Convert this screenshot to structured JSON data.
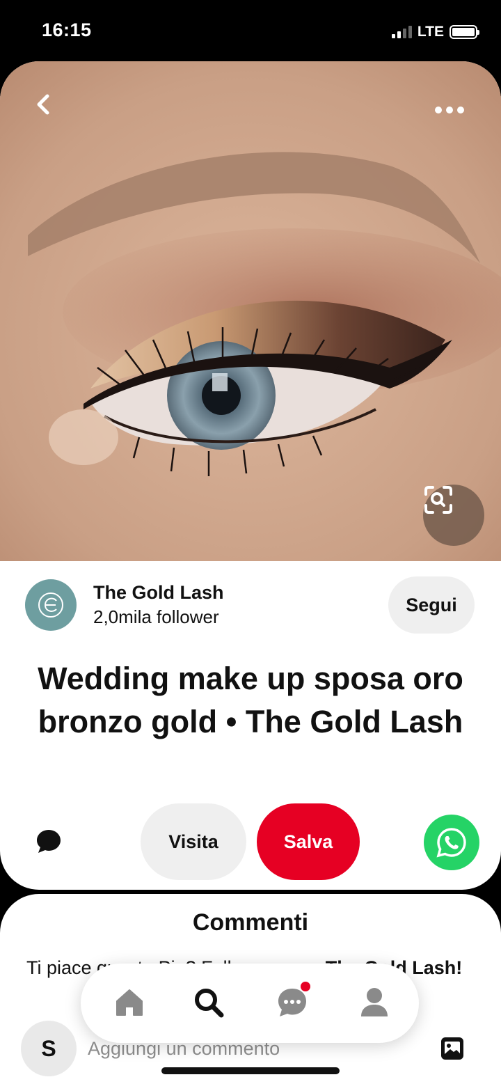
{
  "status_bar": {
    "time": "16:15",
    "network": "LTE",
    "signal_bars": 2,
    "signal_bars_total": 4,
    "battery_icon": "battery-icon"
  },
  "pin": {
    "image_description_icon": "eye-makeup-photo",
    "back_icon": "chevron-left-icon",
    "more_icon": "more-dots-icon",
    "lens_icon": "visual-search-icon",
    "creator": {
      "name": "The Gold Lash",
      "followers": "2,0mila follower",
      "follow_label": "Segui"
    },
    "title": "Wedding make up sposa oro bronzo gold • The Gold Lash",
    "actions": {
      "comment_icon": "speech-bubble-icon",
      "visit_label": "Visita",
      "save_label": "Salva",
      "share_icon": "whatsapp-icon"
    }
  },
  "comments": {
    "heading": "Commenti",
    "prompt_prefix": "Ti piace questo Pin? Fallo sapere a ",
    "prompt_name": "The Gold Lash",
    "prompt_suffix": "!",
    "user_initial": "S",
    "input_placeholder": "Aggiungi un commento",
    "image_icon": "image-icon"
  },
  "bottom_nav": {
    "items": [
      "home-icon",
      "search-icon",
      "messages-icon",
      "profile-icon"
    ],
    "active": "search-icon",
    "notification_on": "messages-icon"
  },
  "colors": {
    "save_red": "#e60023",
    "whatsapp_green": "#25d366",
    "pill_gray": "#efefef",
    "avatar_teal": "#6e9ea0"
  }
}
